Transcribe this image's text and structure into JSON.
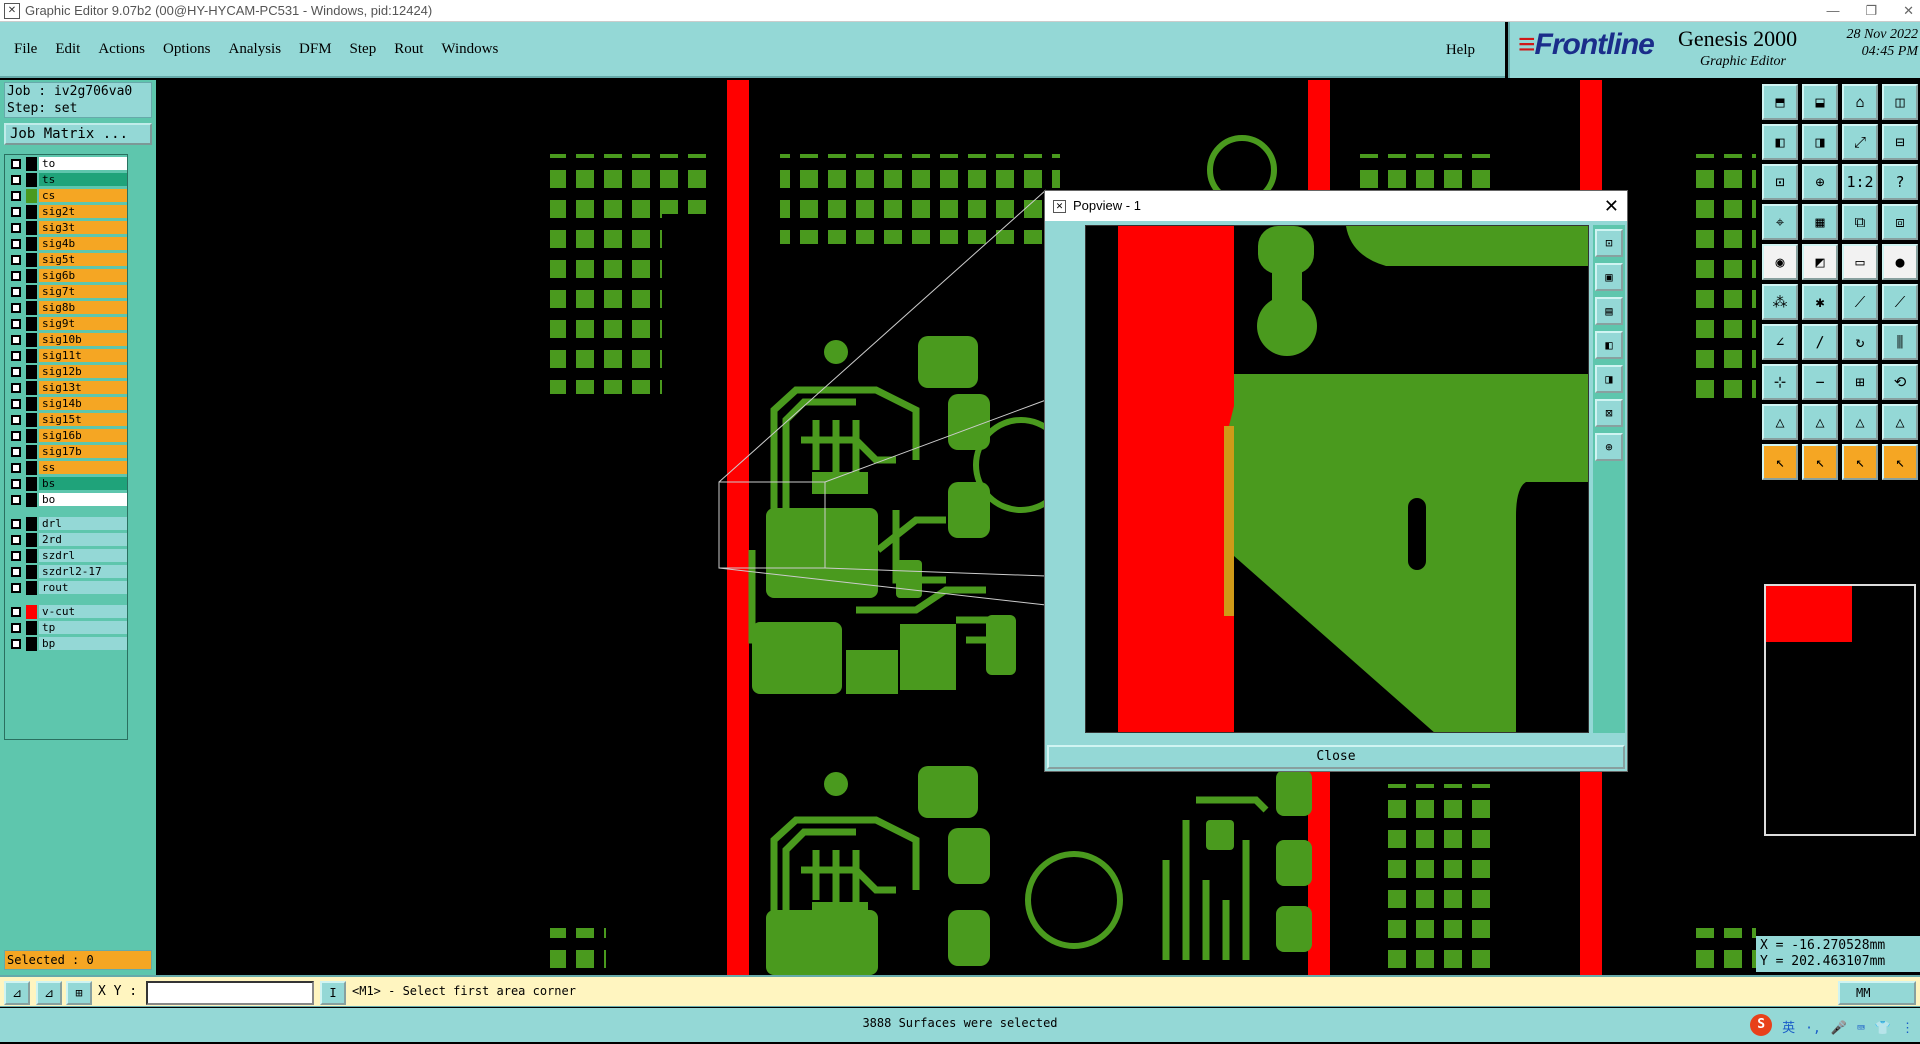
{
  "window": {
    "title": "Graphic Editor 9.07b2 (00@HY-HYCAM-PC531 - Windows, pid:12424)",
    "minimize": "—",
    "restore": "❐",
    "close": "✕"
  },
  "menu": {
    "items": [
      "File",
      "Edit",
      "Actions",
      "Options",
      "Analysis",
      "DFM",
      "Step",
      "Rout",
      "Windows"
    ],
    "help": "Help"
  },
  "brand": {
    "logo": "Frontline",
    "product": "Genesis 2000",
    "subtitle": "Graphic Editor",
    "date": "28 Nov 2022",
    "time": "04:45 PM"
  },
  "job": {
    "job_line": "Job : iv2g706va0",
    "step_line": "Step: set",
    "matrix_button": "Job Matrix ..."
  },
  "layers": [
    {
      "name": "to",
      "bg": "#ffffff"
    },
    {
      "name": "ts",
      "bg": "#1fa37a"
    },
    {
      "name": "cs",
      "bg": "#f5a623",
      "color": "#4a9a1e"
    },
    {
      "name": "sig2t",
      "bg": "#f5a623"
    },
    {
      "name": "sig3t",
      "bg": "#f5a623"
    },
    {
      "name": "sig4b",
      "bg": "#f5a623"
    },
    {
      "name": "sig5t",
      "bg": "#f5a623"
    },
    {
      "name": "sig6b",
      "bg": "#f5a623"
    },
    {
      "name": "sig7t",
      "bg": "#f5a623"
    },
    {
      "name": "sig8b",
      "bg": "#f5a623"
    },
    {
      "name": "sig9t",
      "bg": "#f5a623"
    },
    {
      "name": "sig10b",
      "bg": "#f5a623"
    },
    {
      "name": "sig11t",
      "bg": "#f5a623"
    },
    {
      "name": "sig12b",
      "bg": "#f5a623"
    },
    {
      "name": "sig13t",
      "bg": "#f5a623"
    },
    {
      "name": "sig14b",
      "bg": "#f5a623"
    },
    {
      "name": "sig15t",
      "bg": "#f5a623"
    },
    {
      "name": "sig16b",
      "bg": "#f5a623"
    },
    {
      "name": "sig17b",
      "bg": "#f5a623"
    },
    {
      "name": "ss",
      "bg": "#f5a623"
    },
    {
      "name": "bs",
      "bg": "#1fa37a"
    },
    {
      "name": "bo",
      "bg": "#ffffff"
    },
    {
      "name": "drl",
      "bg": "#94d8d6"
    },
    {
      "name": "2rd",
      "bg": "#94d8d6"
    },
    {
      "name": "szdrl",
      "bg": "#94d8d6"
    },
    {
      "name": "szdrl2-17",
      "bg": "#94d8d6"
    },
    {
      "name": "rout",
      "bg": "#94d8d6"
    },
    {
      "name": "v-cut",
      "bg": "#94d8d6",
      "color": "#ff0000"
    },
    {
      "name": "tp",
      "bg": "#94d8d6"
    },
    {
      "name": "bp",
      "bg": "#94d8d6"
    }
  ],
  "selected": "Selected : 0",
  "coords": {
    "x": "X = -16.270528mm",
    "y": "Y = 202.463107mm"
  },
  "command": {
    "xy_label": "X Y :",
    "xy_value": "",
    "prompt": "<M1> - Select first area corner",
    "units": "MM"
  },
  "status": "3888 Surfaces were selected",
  "tray": [
    "S",
    "英",
    "·,",
    "🎤",
    "⌨",
    "👕",
    "⋮"
  ],
  "popview": {
    "title": "Popview - 1",
    "close_button": "Close"
  },
  "colors": {
    "copper": "#4a9a1e",
    "vcut": "#ff0000",
    "panel": "#94d8d6",
    "panel_dark": "#5ec6ad",
    "highlight": "#f5a623"
  }
}
